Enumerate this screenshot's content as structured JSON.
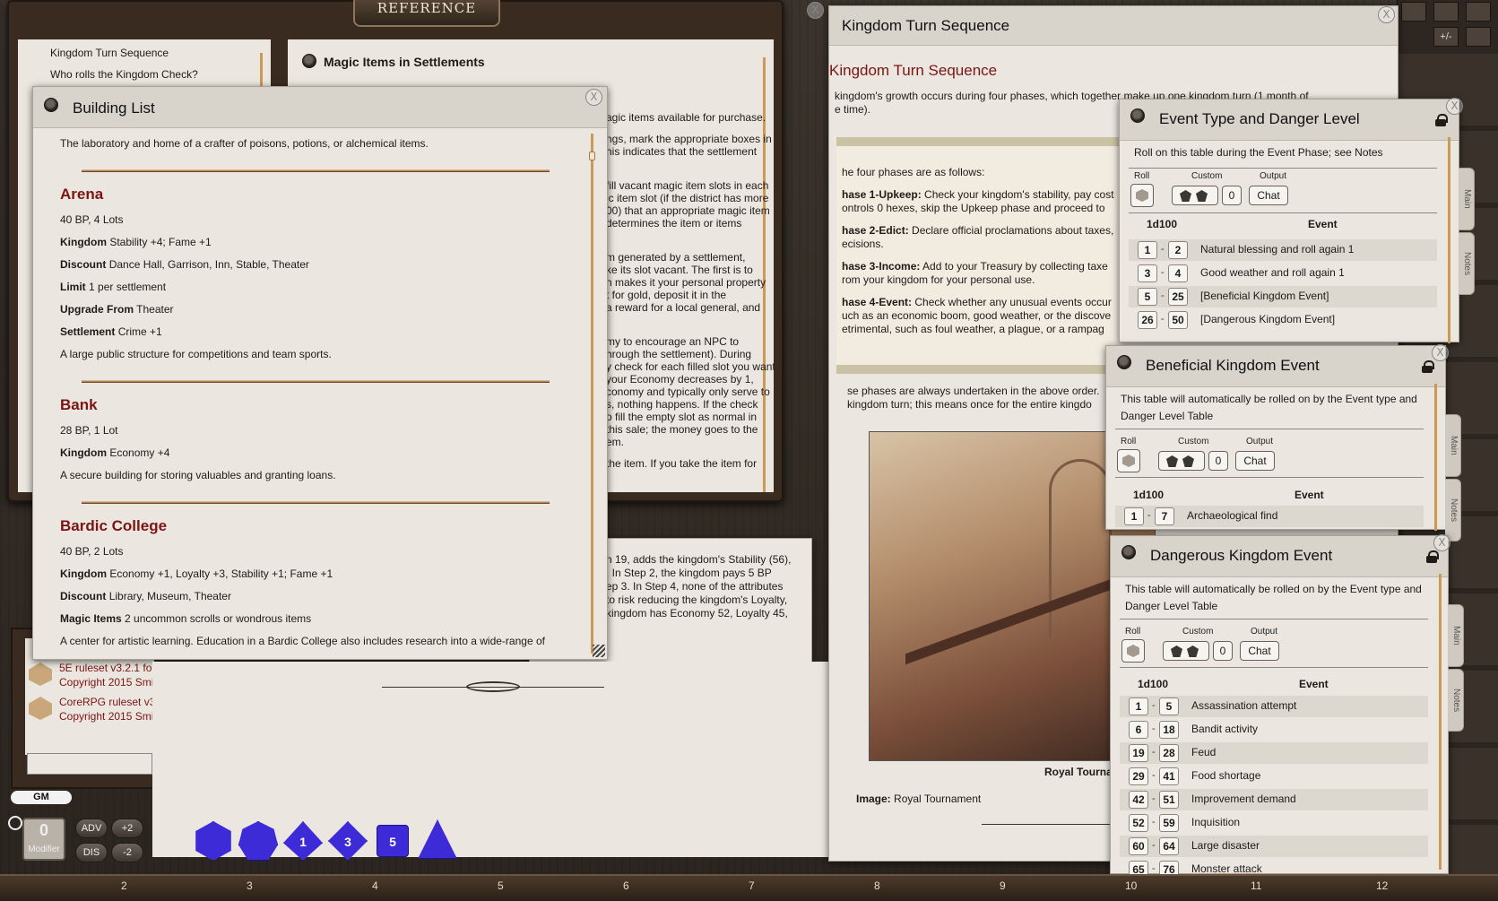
{
  "reference": {
    "title": "REFERENCE",
    "sidebar_items": [
      "Kingdom Turn Sequence",
      "Who rolls the Kingdom Check?"
    ],
    "magic_items_title": "Magic Items in Settlements",
    "magic_lines": [
      "agic items available for purchase.",
      "ngs, mark the appropriate boxes in",
      "his indicates that the settlement",
      "fill vacant magic item slots in each",
      "ic item slot (if the district has more",
      "00) that an appropriate magic item",
      "determines the item or items",
      "m generated by a settlement,",
      "ke its slot vacant. The first is to",
      "h makes it your personal property",
      "t for gold, deposit it in the",
      "a reward for a local general, and",
      "my to encourage an NPC to",
      "hrough the settlement). During",
      "y check for each filled slot you want",
      "your Economy decreases by 1,",
      "conomy and typically only serve to",
      "s, nothing happens. If the check",
      "o fill the empty slot as normal in",
      "this sale; the money goes to the",
      "em.",
      "the item. If you take the item for"
    ],
    "lower_lines": [
      "n 19, adds the kingdom's Stability (56),",
      ". In Step 2, the kingdom pays 5 BP",
      "ep 3. In Step 4, none of the attributes",
      "to risk reducing the kingdom's Loyalty,",
      "kingdom has Economy 52, Loyalty 45,"
    ]
  },
  "building_list": {
    "title": "Building List",
    "intro": "The laboratory and home of a crafter of poisons, potions, or alchemical items.",
    "arena": {
      "name": "Arena",
      "cost": "40 BP, 4 Lots",
      "kingdom_label": "Kingdom",
      "kingdom": "Stability +4; Fame +1",
      "discount_label": "Discount",
      "discount": "Dance Hall, Garrison, Inn, Stable, Theater",
      "limit_label": "Limit",
      "limit": "1 per settlement",
      "upgrade_label": "Upgrade From",
      "upgrade": "Theater",
      "settlement_label": "Settlement",
      "settlement": "Crime +1",
      "desc": "A large public structure for competitions and team sports."
    },
    "bank": {
      "name": "Bank",
      "cost": "28 BP, 1 Lot",
      "kingdom_label": "Kingdom",
      "kingdom": "Economy +4",
      "desc": "A secure building for storing valuables and granting loans."
    },
    "bardic": {
      "name": "Bardic College",
      "cost": "40 BP, 2 Lots",
      "kingdom_label": "Kingdom",
      "kingdom": "Economy +1, Loyalty +3, Stability +1; Fame +1",
      "discount_label": "Discount",
      "discount": "Library, Museum, Theater",
      "magic_label": "Magic Items",
      "magic": "2 uncommon scrolls or wondrous items",
      "desc": "A center for artistic learning. Education in a Bardic College also includes research into a wide-range of"
    }
  },
  "kingdom_turn": {
    "title": "Kingdom Turn Sequence",
    "heading": "Kingdom Turn Sequence",
    "intro1": "kingdom's growth occurs during four phases, which together make up one kingdom turn (1 month of",
    "intro2": "e time).",
    "phases_intro": "he four phases are as follows:",
    "phase1_label": "hase 1-Upkeep:",
    "phase1": "Check your kingdom's stability, pay cost",
    "phase1b": "ontrols 0 hexes, skip the Upkeep phase and proceed to",
    "phase2_label": "hase 2-Edict:",
    "phase2": "Declare official proclamations about taxes,",
    "phase2b": "ecisions.",
    "phase3_label": "hase 3-Income:",
    "phase3": "Add to your Treasury by collecting taxe",
    "phase3b": "rom your kingdom for your personal use.",
    "phase4_label": "hase 4-Event:",
    "phase4": "Check whether any unusual events occur",
    "phase4b": "uch as an economic boom, good weather, or the discove",
    "phase4c": "etrimental, such as foul weather, a plague, or a rampag",
    "after1": "se phases are always undertaken in the above order.",
    "after2": "kingdom turn; this means once for the entire kingdo",
    "caption": "Royal Tourna",
    "image_label": "Image:",
    "image_name": "Royal Tournament"
  },
  "event_type": {
    "title": "Event Type and Danger Level",
    "desc": "Roll on this table during the Event Phase; see Notes",
    "roll_label": "Roll",
    "custom_label": "Custom",
    "output_label": "Output",
    "custom_value": "0",
    "chat": "Chat",
    "col_dice": "1d100",
    "col_event": "Event",
    "rows": [
      {
        "a": "1",
        "b": "2",
        "e": "Natural blessing and roll again 1"
      },
      {
        "a": "3",
        "b": "4",
        "e": "Good weather and roll again 1"
      },
      {
        "a": "5",
        "b": "25",
        "e": "[Beneficial Kingdom Event]"
      },
      {
        "a": "26",
        "b": "50",
        "e": "[Dangerous Kingdom Event]"
      }
    ],
    "tabs": [
      "Main",
      "Notes"
    ]
  },
  "beneficial": {
    "title": "Beneficial Kingdom Event",
    "desc1": "This table will automatically be rolled on by the Event type and",
    "desc2": "Danger Level Table",
    "roll_label": "Roll",
    "custom_label": "Custom",
    "output_label": "Output",
    "custom_value": "0",
    "chat": "Chat",
    "col_dice": "1d100",
    "col_event": "Event",
    "rows": [
      {
        "a": "1",
        "b": "7",
        "e": "Archaeological find"
      }
    ],
    "tabs": [
      "Main",
      "Notes"
    ]
  },
  "dangerous": {
    "title": "Dangerous Kingdom Event",
    "desc1": "This table will automatically be rolled on by the Event type and",
    "desc2": "Danger Level Table",
    "roll_label": "Roll",
    "custom_label": "Custom",
    "output_label": "Output",
    "custom_value": "0",
    "chat": "Chat",
    "col_dice": "1d100",
    "col_event": "Event",
    "rows": [
      {
        "a": "1",
        "b": "5",
        "e": "Assassination attempt"
      },
      {
        "a": "6",
        "b": "18",
        "e": "Bandit activity"
      },
      {
        "a": "19",
        "b": "28",
        "e": "Feud"
      },
      {
        "a": "29",
        "b": "41",
        "e": "Food shortage"
      },
      {
        "a": "42",
        "b": "51",
        "e": "Improvement demand"
      },
      {
        "a": "52",
        "b": "59",
        "e": "Inquisition"
      },
      {
        "a": "60",
        "b": "64",
        "e": "Large disaster"
      },
      {
        "a": "65",
        "b": "76",
        "e": "Monster attack"
      }
    ],
    "tabs": [
      "Main",
      "Notes"
    ]
  },
  "chat": {
    "line1a": "5E ruleset v3.2.1 for",
    "line1b": "Copyright 2015 Smi",
    "line2a": "CoreRPG ruleset v3",
    "line2b": "Copyright 2015 Smi",
    "gm_label": "GM",
    "modifier_value": "0",
    "modifier_label": "Modifier",
    "adv": "ADV",
    "dis": "DIS",
    "plus2": "+2",
    "minus2": "-2"
  },
  "dice": [
    "d20",
    "d12",
    "d10",
    "d8",
    "d6",
    "d4"
  ],
  "dice_faces": [
    "",
    "",
    "1",
    "3",
    "5",
    ""
  ],
  "hotbar": [
    "2",
    "3",
    "4",
    "5",
    "6",
    "7",
    "8",
    "9",
    "10",
    "11",
    "12"
  ],
  "toolbar": {
    "plus_minus": "+/-"
  },
  "colors": {
    "accent_red": "#7b1414",
    "dice_blue": "#3d2bd8",
    "rule_gold": "#b1845a"
  }
}
